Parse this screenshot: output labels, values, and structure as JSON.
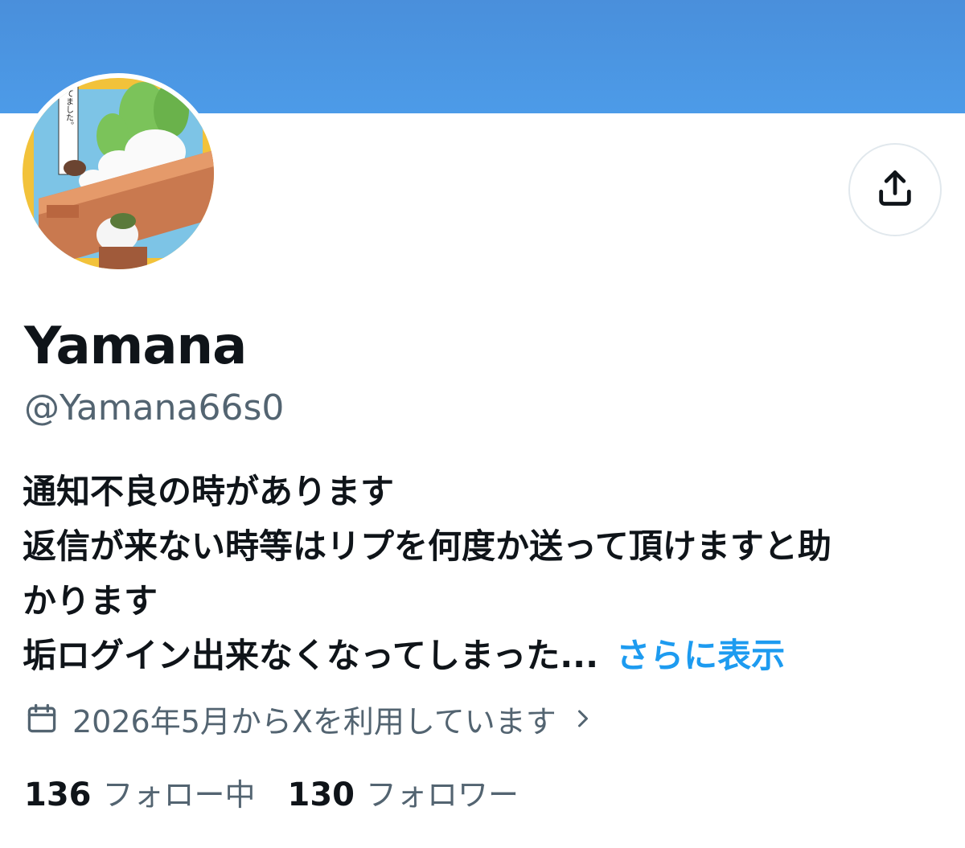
{
  "colors": {
    "banner": "#4c9be8",
    "link": "#1d9bf0",
    "secondary_text": "#536471",
    "primary_text": "#0f1419"
  },
  "header": {
    "share_icon": "share-upload-icon"
  },
  "avatar": {
    "description_icon": "avatar-image",
    "sign_text": "私が育てました。"
  },
  "profile": {
    "display_name": "Yamana",
    "handle": "@Yamana66s0",
    "bio_lines": [
      "通知不良の時があります",
      "返信が来ない時等はリプを何度か送って頂けますと助",
      "かります",
      "垢ログイン出来なくなってしまった..."
    ],
    "show_more": "さらに表示",
    "joined": "2026年5月からXを利用しています",
    "joined_icon": "calendar-icon",
    "chevron_icon": "chevron-right-icon"
  },
  "stats": {
    "following_count": "136",
    "following_label": "フォロー中",
    "followers_count": "130",
    "followers_label": "フォロワー"
  }
}
